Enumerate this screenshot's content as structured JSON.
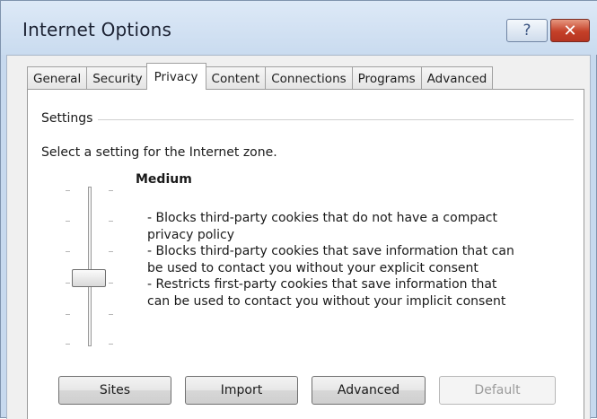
{
  "window": {
    "title": "Internet Options",
    "help_glyph": "?",
    "close_glyph": "✕"
  },
  "tabs": [
    {
      "label": "General",
      "active": false
    },
    {
      "label": "Security",
      "active": false
    },
    {
      "label": "Privacy",
      "active": true
    },
    {
      "label": "Content",
      "active": false
    },
    {
      "label": "Connections",
      "active": false
    },
    {
      "label": "Programs",
      "active": false
    },
    {
      "label": "Advanced",
      "active": false
    }
  ],
  "settings": {
    "group_label": "Settings",
    "zone_text": "Select a setting for the Internet zone.",
    "level_name": "Medium",
    "description_lines": [
      "- Blocks third-party cookies that do not have a compact",
      "privacy policy",
      "- Blocks third-party cookies that save information that can",
      "be used to contact you without your explicit consent",
      "- Restricts first-party cookies that save information that",
      "can be used to contact you without your implicit consent"
    ]
  },
  "buttons": {
    "sites": "Sites",
    "import": "Import",
    "advanced": "Advanced",
    "default": "Default"
  }
}
